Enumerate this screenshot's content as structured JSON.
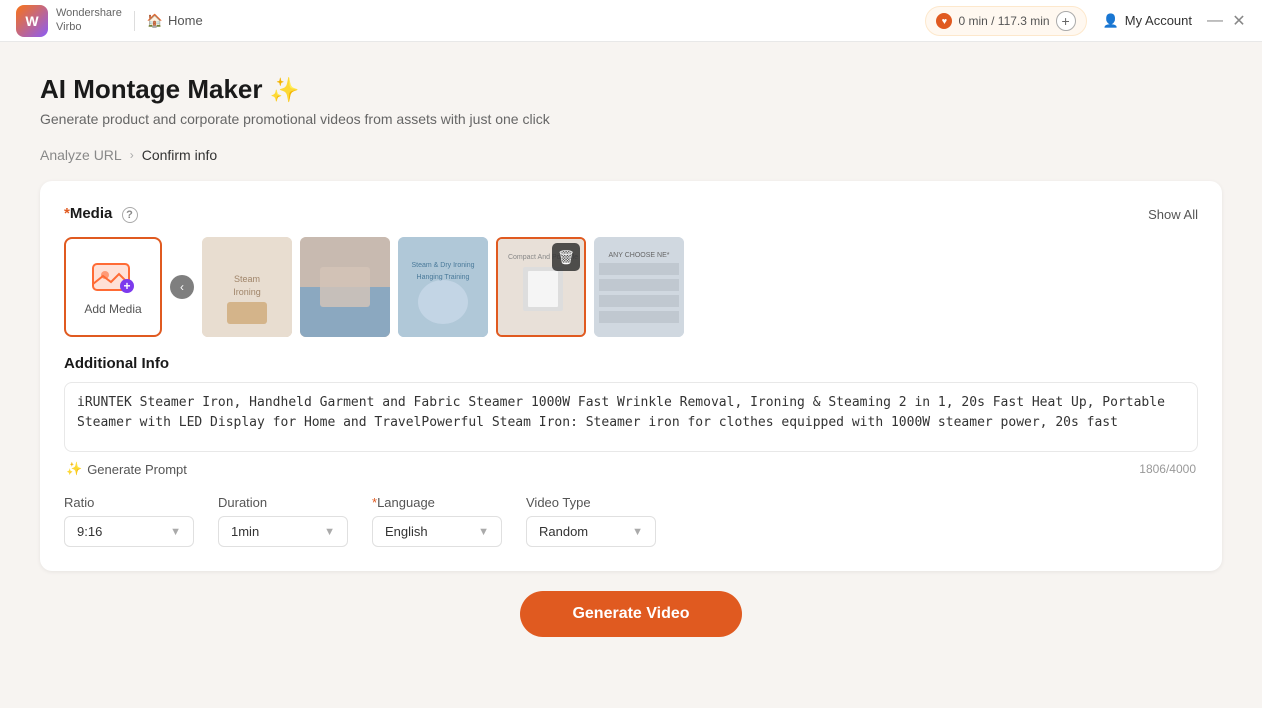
{
  "app": {
    "name": "Wondershare",
    "product": "Virbo"
  },
  "titlebar": {
    "home_label": "Home",
    "credits_text": "0 min / 117.3 min",
    "add_label": "+",
    "account_label": "My Account",
    "minimize_label": "—",
    "close_label": "✕"
  },
  "page": {
    "title": "AI Montage Maker",
    "wand": "✨",
    "subtitle": "Generate product and corporate promotional videos from assets with just one click",
    "breadcrumb": {
      "step1": "Analyze URL",
      "sep": "›",
      "step2": "Confirm info"
    }
  },
  "card": {
    "media_label": "Media",
    "media_required": "*",
    "help_icon": "?",
    "show_all_label": "Show All",
    "add_media_label": "Add Media",
    "nav_prev": "‹",
    "additional_info_title": "Additional Info",
    "textarea_content": "iRUNTEK Steamer Iron, Handheld Garment and Fabric Steamer 1000W Fast Wrinkle Removal, Ironing &amp; Steaming 2 in 1, 20s Fast Heat Up, Portable Steamer with LED Display for Home and TravelPowerful Steam Iron: Steamer iron for clothes equipped with 1000W steamer power, 20s fast",
    "generate_prompt_label": "Generate Prompt",
    "char_count": "1806/4000",
    "settings": {
      "ratio_label": "Ratio",
      "ratio_value": "9:16",
      "duration_label": "Duration",
      "duration_value": "1min",
      "language_label": "Language",
      "language_required": "*",
      "language_value": "English",
      "video_type_label": "Video Type",
      "video_type_value": "Random"
    }
  },
  "footer": {
    "generate_btn_label": "Generate Video"
  }
}
